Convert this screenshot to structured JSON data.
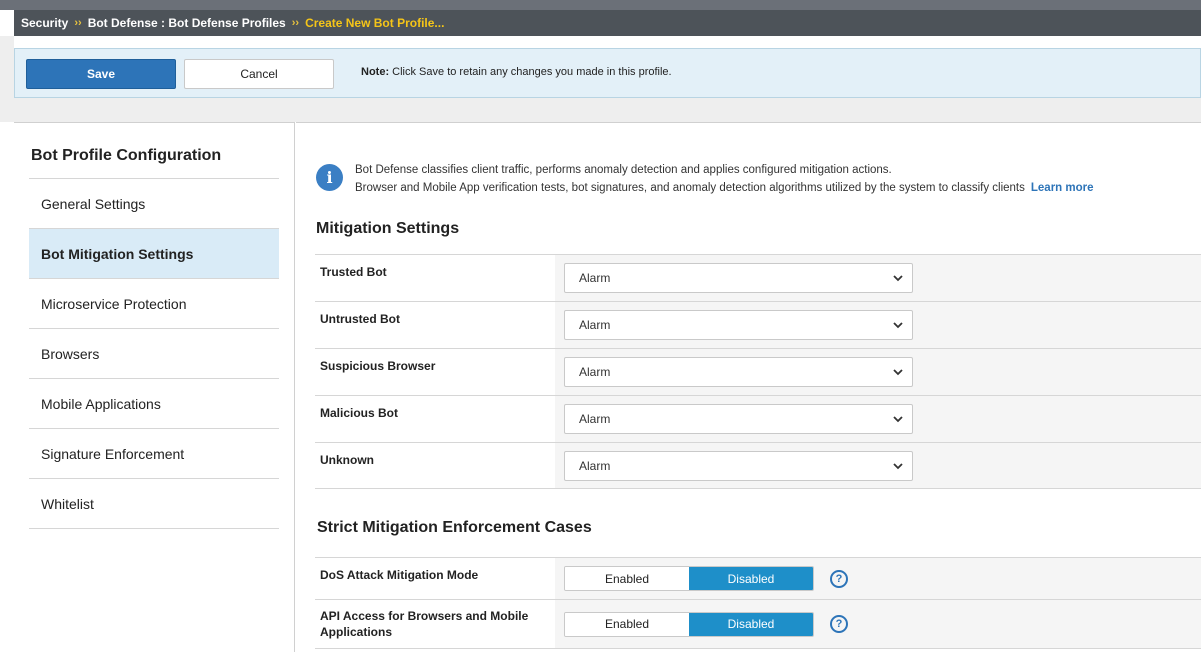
{
  "breadcrumb": {
    "items": [
      "Security",
      "Bot Defense : Bot Defense Profiles"
    ],
    "separator": "››",
    "current": "Create New Bot Profile..."
  },
  "toolbar": {
    "save_label": "Save",
    "cancel_label": "Cancel",
    "note_prefix": "Note:",
    "note_text": "Click Save to retain any changes you made in this profile."
  },
  "sidebar": {
    "title": "Bot Profile Configuration",
    "items": [
      {
        "label": "General Settings"
      },
      {
        "label": "Bot Mitigation Settings",
        "active": true
      },
      {
        "label": "Microservice Protection"
      },
      {
        "label": "Browsers"
      },
      {
        "label": "Mobile Applications"
      },
      {
        "label": "Signature Enforcement"
      },
      {
        "label": "Whitelist"
      }
    ]
  },
  "info": {
    "line1": "Bot Defense classifies client traffic, performs anomaly detection and applies configured mitigation actions.",
    "line2": "Browser and Mobile App verification tests, bot signatures, and anomaly detection algorithms utilized by the system to classify clients",
    "learn_more": "Learn more",
    "icon": "info-icon"
  },
  "mitigation": {
    "title": "Mitigation Settings",
    "rows": [
      {
        "label": "Trusted Bot",
        "value": "Alarm"
      },
      {
        "label": "Untrusted Bot",
        "value": "Alarm"
      },
      {
        "label": "Suspicious Browser",
        "value": "Alarm"
      },
      {
        "label": "Malicious Bot",
        "value": "Alarm"
      },
      {
        "label": "Unknown",
        "value": "Alarm"
      }
    ]
  },
  "strict": {
    "title": "Strict Mitigation Enforcement Cases",
    "rows": [
      {
        "label": "DoS Attack Mitigation Mode",
        "enabled_label": "Enabled",
        "disabled_label": "Disabled",
        "selected": "Disabled"
      },
      {
        "label": "API Access for Browsers and Mobile Applications",
        "enabled_label": "Enabled",
        "disabled_label": "Disabled",
        "selected": "Disabled"
      }
    ]
  },
  "colors": {
    "primary": "#2d74b8",
    "toggle_active": "#1e8fc9",
    "breadcrumb_bg": "#4d5359",
    "breadcrumb_current": "#f5c518",
    "active_nav_bg": "#d9ebf7"
  }
}
